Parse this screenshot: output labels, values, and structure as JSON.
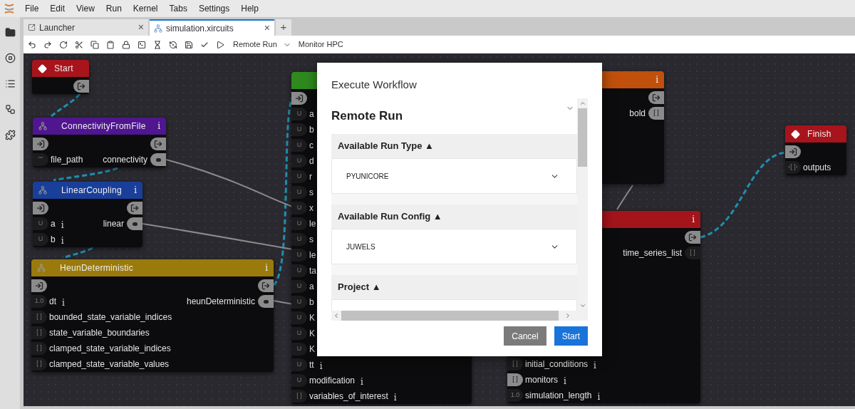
{
  "menu": [
    "File",
    "Edit",
    "View",
    "Run",
    "Kernel",
    "Tabs",
    "Settings",
    "Help"
  ],
  "tabs": [
    {
      "label": "Launcher",
      "selected": false,
      "kind": "launcher",
      "close": "×"
    },
    {
      "label": "simulation.xircuits",
      "selected": true,
      "kind": "workflow",
      "close": "×"
    }
  ],
  "new_tab": "+",
  "toolbar": {
    "run_mode": "Remote Run",
    "monitor": "Monitor HPC"
  },
  "nodes": [
    {
      "kind": "start",
      "title": "Start",
      "color": "#a8141c",
      "exec_in": false,
      "exec_out": true
    },
    {
      "kind": "component",
      "title": "ConnectivityFromFile",
      "info": "i",
      "color": "#4f1690",
      "exec_in": true,
      "exec_out": true,
      "rows": [
        {
          "in": {
            "badge": "\"\"",
            "label": "file_path"
          },
          "out": {
            "label": "connectivity",
            "connected": true
          }
        }
      ]
    },
    {
      "kind": "component",
      "title": "LinearCoupling",
      "info": "i",
      "color": "#1a3f9a",
      "exec_in": true,
      "exec_out": true,
      "rows": [
        {
          "in": {
            "badge": "U",
            "label": "a",
            "info": "i"
          },
          "out": {
            "label": "linear",
            "connected": true
          }
        },
        {
          "in": {
            "badge": "U",
            "label": "b",
            "info": "i"
          }
        }
      ]
    },
    {
      "kind": "component",
      "title": "HeunDeterministic",
      "info": "i",
      "color": "#9a7a0c",
      "exec_in": true,
      "exec_out": true,
      "rows": [
        {
          "in": {
            "badge": "1.0",
            "label": "dt",
            "info": "i"
          },
          "out": {
            "label": "heunDeterministic",
            "connected": true
          }
        },
        {
          "in": {
            "badge": "[ ]",
            "label": "bounded_state_variable_indices"
          }
        },
        {
          "in": {
            "badge": "[ ]",
            "label": "state_variable_boundaries"
          }
        },
        {
          "in": {
            "badge": "[ ]",
            "label": "clamped_state_variable_indices"
          }
        },
        {
          "in": {
            "badge": "[ ]",
            "label": "clamped_state_variable_values"
          }
        }
      ]
    },
    {
      "kind": "component",
      "color": "#2f8a1e",
      "exec_in": true,
      "exec_out": false,
      "rows": [
        {
          "in": {
            "badge": "U",
            "label": "a"
          }
        },
        {
          "in": {
            "badge": "U",
            "label": "b"
          }
        },
        {
          "in": {
            "badge": "U",
            "label": "c"
          }
        },
        {
          "in": {
            "badge": "U",
            "label": "d"
          }
        },
        {
          "in": {
            "badge": "U",
            "label": "r"
          }
        },
        {
          "in": {
            "badge": "U",
            "label": "s"
          }
        },
        {
          "in": {
            "badge": "U",
            "label": "x"
          }
        },
        {
          "in": {
            "badge": "U",
            "label": "le"
          }
        },
        {
          "in": {
            "badge": "U",
            "label": "s"
          }
        },
        {
          "in": {
            "badge": "U",
            "label": "le"
          }
        },
        {
          "in": {
            "badge": "U",
            "label": "ta"
          }
        },
        {
          "in": {
            "badge": "U",
            "label": "a"
          }
        },
        {
          "in": {
            "badge": "U",
            "label": "b"
          }
        },
        {
          "in": {
            "badge": "U",
            "label": "K"
          }
        },
        {
          "in": {
            "badge": "U",
            "label": "K"
          }
        },
        {
          "in": {
            "badge": "U",
            "label": "K"
          }
        },
        {
          "in": {
            "badge": "U",
            "label": "tt",
            "info": "i"
          }
        },
        {
          "in": {
            "badge": "U",
            "label": "modification",
            "info": "i"
          }
        },
        {
          "in": {
            "badge": "[ ]",
            "label": "variables_of_interest",
            "info": "i"
          }
        }
      ]
    },
    {
      "kind": "component",
      "info": "i",
      "color": "#c0500c",
      "exec_in": false,
      "exec_out": true,
      "rows": [
        {
          "out": {
            "label": "bold",
            "badge": "[ ]",
            "connected": true
          }
        }
      ]
    },
    {
      "kind": "component",
      "info": "i",
      "color": "#a3141b",
      "exec_in": false,
      "exec_out": true,
      "rows": [
        {
          "out": {
            "label": "time_series_list",
            "badge": "[ ]",
            "connected": false
          }
        }
      ],
      "lower_rows": [
        {
          "in": {
            "badge": "[ ]",
            "label": "initial_conditions",
            "info": "i"
          }
        },
        {
          "in": {
            "badge": "[ ]",
            "label": "monitors",
            "info": "i",
            "connected": true
          }
        },
        {
          "in": {
            "badge": "1.0",
            "label": "simulation_length",
            "info": "i"
          }
        }
      ]
    },
    {
      "kind": "finish",
      "title": "Finish",
      "color": "#a8141c",
      "exec_in": true,
      "exec_out": false,
      "rows": [
        {
          "in": {
            "badge": "‹[ ]›",
            "label": "outputs"
          }
        }
      ]
    }
  ],
  "dialog": {
    "title": "Execute Workflow",
    "heading": "Remote Run",
    "sections": [
      {
        "label": "Available Run Type ▲",
        "value": "PYUNICORE"
      },
      {
        "label": "Available Run Config ▲",
        "value": "JUWELS"
      },
      {
        "label": "Project ▲"
      }
    ],
    "buttons": [
      {
        "label": "Cancel",
        "kind": "secondary"
      },
      {
        "label": "Start",
        "kind": "primary"
      }
    ]
  }
}
